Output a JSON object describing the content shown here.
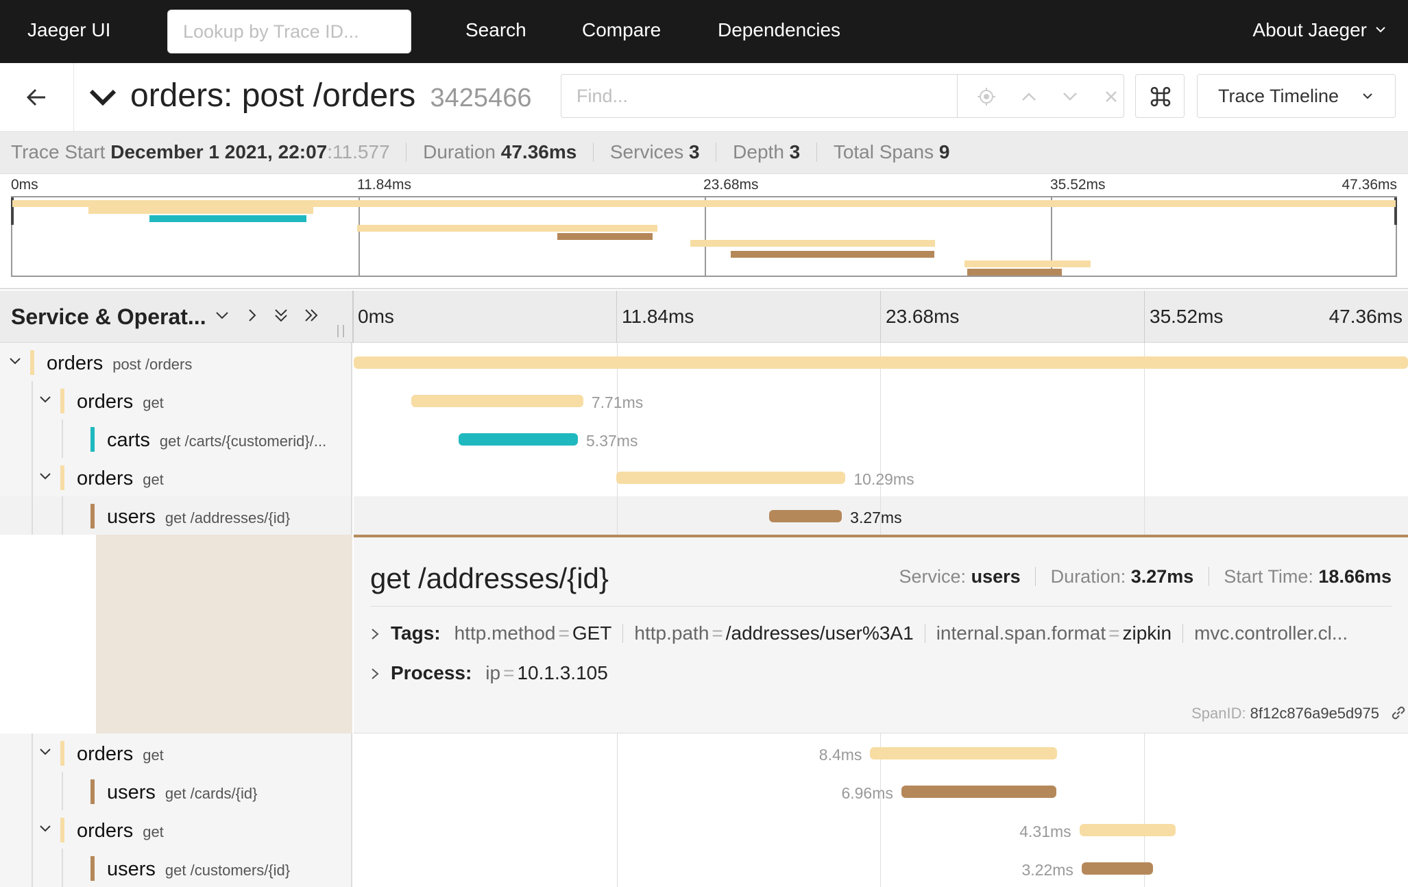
{
  "nav": {
    "brand": "Jaeger UI",
    "lookup_placeholder": "Lookup by Trace ID...",
    "links": [
      "Search",
      "Compare",
      "Dependencies"
    ],
    "about": "About Jaeger"
  },
  "trace": {
    "service": "orders:",
    "operation": "post /orders",
    "trace_id": "3425466",
    "find_placeholder": "Find...",
    "view_mode": "Trace Timeline"
  },
  "summary": {
    "trace_start_label": "Trace Start",
    "trace_start_date": "December 1 2021, 22:07",
    "trace_start_ms": ":11.577",
    "duration_label": "Duration",
    "duration": "47.36ms",
    "services_label": "Services",
    "services": "3",
    "depth_label": "Depth",
    "depth": "3",
    "total_spans_label": "Total Spans",
    "total_spans": "9"
  },
  "ticks": [
    "0ms",
    "11.84ms",
    "23.68ms",
    "35.52ms",
    "47.36ms"
  ],
  "timeline_header": {
    "title": "Service & Operat..."
  },
  "colors": {
    "orders": "#f7dda4",
    "carts": "#1fb8bf",
    "users": "#b5885a"
  },
  "spans": [
    {
      "service": "orders",
      "operation": "post /orders",
      "start_ms": 0.0,
      "duration_ms": 47.36,
      "duration_label": ""
    },
    {
      "service": "orders",
      "operation": "get",
      "start_ms": 2.6,
      "duration_ms": 7.71,
      "duration_label": "7.71ms"
    },
    {
      "service": "carts",
      "operation": "get /carts/{customerid}/...",
      "start_ms": 4.7,
      "duration_ms": 5.37,
      "duration_label": "5.37ms"
    },
    {
      "service": "orders",
      "operation": "get",
      "start_ms": 11.8,
      "duration_ms": 10.29,
      "duration_label": "10.29ms"
    },
    {
      "service": "users",
      "operation": "get /addresses/{id}",
      "start_ms": 18.66,
      "duration_ms": 3.27,
      "duration_label": "3.27ms"
    },
    {
      "service": "orders",
      "operation": "get",
      "start_ms": 23.2,
      "duration_ms": 8.4,
      "duration_label": "8.4ms"
    },
    {
      "service": "users",
      "operation": "get /cards/{id}",
      "start_ms": 24.6,
      "duration_ms": 6.96,
      "duration_label": "6.96ms"
    },
    {
      "service": "orders",
      "operation": "get",
      "start_ms": 32.6,
      "duration_ms": 4.31,
      "duration_label": "4.31ms"
    },
    {
      "service": "users",
      "operation": "get /customers/{id}",
      "start_ms": 32.7,
      "duration_ms": 3.22,
      "duration_label": "3.22ms"
    }
  ],
  "detail": {
    "operation": "get /addresses/{id}",
    "service_label": "Service:",
    "service": "users",
    "duration_label": "Duration:",
    "duration": "3.27ms",
    "start_label": "Start Time:",
    "start": "18.66ms",
    "tags_label": "Tags:",
    "tags": [
      {
        "key": "http.method",
        "value": "GET"
      },
      {
        "key": "http.path",
        "value": "/addresses/user%3A1"
      },
      {
        "key": "internal.span.format",
        "value": "zipkin"
      },
      {
        "key": "mvc.controller.cl...",
        "value": ""
      }
    ],
    "process_label": "Process:",
    "process": [
      {
        "key": "ip",
        "value": "10.1.3.105"
      }
    ],
    "span_id_label": "SpanID:",
    "span_id": "8f12c876a9e5d975"
  }
}
